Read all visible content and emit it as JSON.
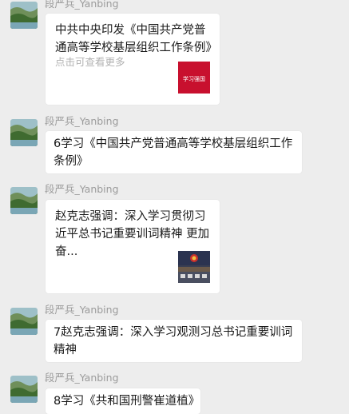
{
  "messages": [
    {
      "sender": "段严兵_Yanbing",
      "type": "link-card",
      "title": "中共中央印发《中国共产党普通高等学校基层组织工作条例》",
      "description": "点击可查看更多",
      "thumb_logo_text": "学习强国"
    },
    {
      "sender": "段严兵_Yanbing",
      "type": "text",
      "text": "6学习《中国共产党普通高等学校基层组织工作条例》"
    },
    {
      "sender": "段严兵_Yanbing",
      "type": "link-card",
      "title": "赵克志强调：深入学习贯彻习近平总书记重要训词精神 更加奋..."
    },
    {
      "sender": "段严兵_Yanbing",
      "type": "text",
      "text": "7赵克志强调：深入学习观测习总书记重要训词精神"
    },
    {
      "sender": "段严兵_Yanbing",
      "type": "text",
      "text": "8学习《共和国刑警崔道植》"
    }
  ]
}
